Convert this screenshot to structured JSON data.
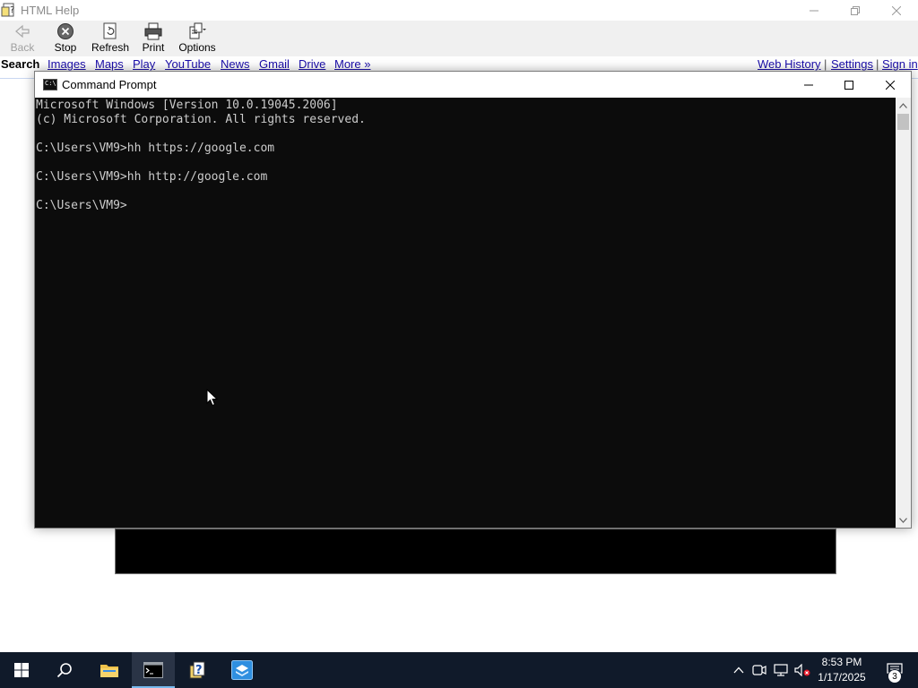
{
  "help_window": {
    "title": "HTML Help",
    "toolbar": {
      "back_label": "Back",
      "stop_label": "Stop",
      "refresh_label": "Refresh",
      "print_label": "Print",
      "options_label": "Options"
    },
    "google_bar": {
      "search": "Search",
      "images": "Images",
      "maps": "Maps",
      "play": "Play",
      "youtube": "YouTube",
      "news": "News",
      "gmail": "Gmail",
      "drive": "Drive",
      "more": "More »",
      "web_history": "Web History",
      "separator": "|",
      "settings": "Settings",
      "sign_in": "Sign in"
    }
  },
  "cmd_window": {
    "title": "Command Prompt",
    "icon_text": "C:\\",
    "lines": [
      "Microsoft Windows [Version 10.0.19045.2006]",
      "(c) Microsoft Corporation. All rights reserved.",
      "",
      "C:\\Users\\VM9>hh https://google.com",
      "",
      "C:\\Users\\VM9>hh http://google.com",
      "",
      "C:\\Users\\VM9>"
    ]
  },
  "taskbar": {
    "time": "8:53 PM",
    "date": "1/17/2025",
    "notification_count": "3",
    "accent_color": "#76b9ed",
    "icons": [
      "windows-start-icon",
      "search-icon",
      "file-explorer-icon",
      "command-prompt-icon",
      "html-help-icon",
      "sandbox-app-icon"
    ]
  },
  "colors": {
    "console_background": "#0c0c0c",
    "console_text": "#cccccc",
    "link": "#1a0dab",
    "taskbar": "#101a2a"
  }
}
